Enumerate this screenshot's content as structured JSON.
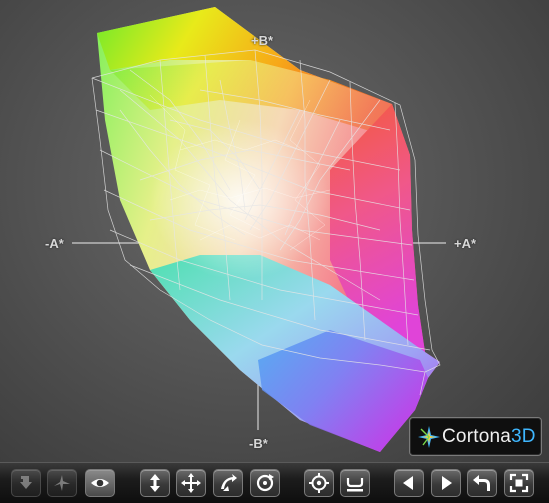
{
  "viewer": {
    "axis_labels": {
      "plus_b": "+B*",
      "minus_b": "-B*",
      "minus_a": "-A*",
      "plus_a": "+A*"
    }
  },
  "brand": {
    "name_main": "Cortona",
    "name_accent": "3D",
    "accent_color": "#3fb7ff"
  },
  "toolbar": {
    "buttons": [
      {
        "name": "restore-view-button",
        "icon": "restore-icon",
        "enabled": false
      },
      {
        "name": "fly-mode-button",
        "icon": "airplane-icon",
        "enabled": false
      },
      {
        "name": "study-mode-button",
        "icon": "eye-icon",
        "enabled": true
      },
      {
        "name": "pan-vertical-button",
        "icon": "vertical-arrows-icon",
        "enabled": true
      },
      {
        "name": "pan-button",
        "icon": "four-arrows-icon",
        "enabled": true
      },
      {
        "name": "tilt-button",
        "icon": "tilt-icon",
        "enabled": true
      },
      {
        "name": "rotate-button",
        "icon": "rotate-icon",
        "enabled": true
      },
      {
        "name": "goto-button",
        "icon": "target-icon",
        "enabled": true
      },
      {
        "name": "align-button",
        "icon": "align-icon",
        "enabled": true
      },
      {
        "name": "previous-viewpoint-button",
        "icon": "triangle-left-icon",
        "enabled": true
      },
      {
        "name": "next-viewpoint-button",
        "icon": "triangle-right-icon",
        "enabled": true
      },
      {
        "name": "undo-move-button",
        "icon": "undo-arrow-icon",
        "enabled": true
      },
      {
        "name": "fit-button",
        "icon": "fit-frame-icon",
        "enabled": true
      }
    ]
  }
}
